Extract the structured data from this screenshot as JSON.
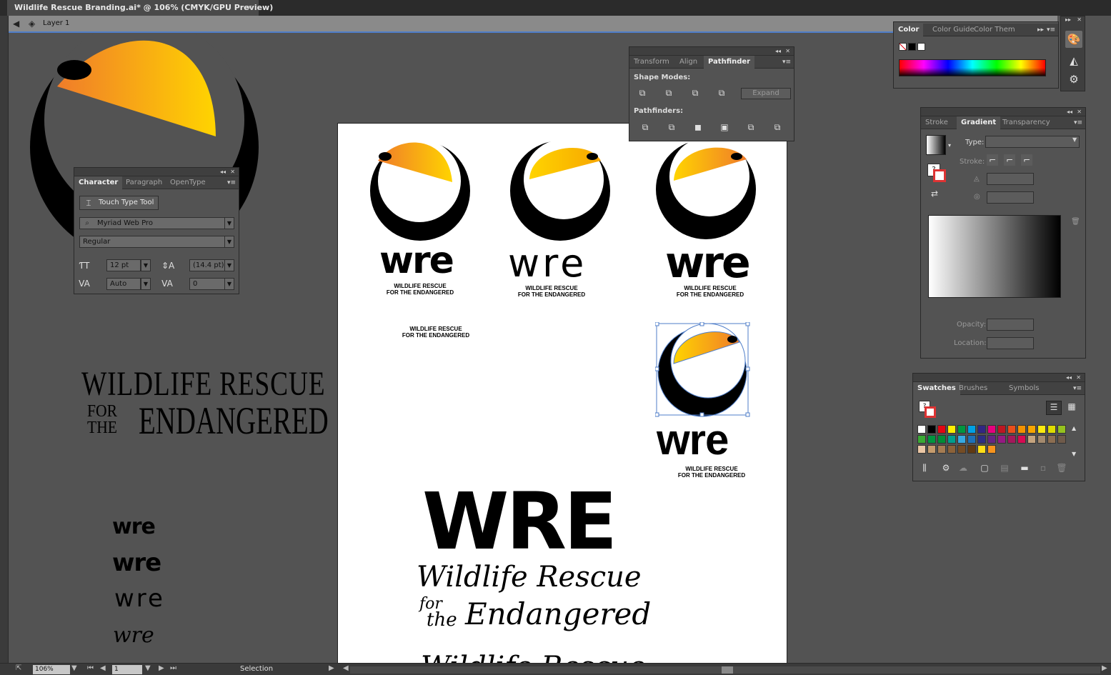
{
  "document_tab": {
    "title": "Wildlife Rescue Branding.ai* @ 106% (CMYK/GPU Preview)",
    "close": "×"
  },
  "layer_bar": {
    "layer_name": "Layer 1"
  },
  "canvas": {
    "logo_word": "wre",
    "logo_word_thin": "wre",
    "tagline_line1": "WILDLIFE RESCUE",
    "tagline_line2": "FOR THE ENDANGERED",
    "serif_line1": "WILDLIFE RESCUE",
    "serif_for": "FOR",
    "serif_the": "THE",
    "serif_endangered": "ENDANGERED",
    "wre_samples": [
      "wre",
      "wre",
      "wre",
      "wre"
    ],
    "big_caps": "WRE",
    "script_line1": "Wildlife Rescue",
    "script_for": "for",
    "script_the": "the",
    "script_endangered": "Endangered",
    "script_partial": "Wildlife Rescue"
  },
  "character_panel": {
    "tabs": [
      "Character",
      "Paragraph",
      "OpenType"
    ],
    "touch_type_button": "Touch Type Tool",
    "font_family": "Myriad Web Pro",
    "font_style": "Regular",
    "font_size": "12 pt",
    "leading": "(14.4 pt)",
    "kerning": "Auto",
    "tracking": "0"
  },
  "pathfinder_panel": {
    "tabs": [
      "Transform",
      "Align",
      "Pathfinder"
    ],
    "shape_modes_label": "Shape Modes:",
    "pathfinders_label": "Pathfinders:",
    "expand_button": "Expand"
  },
  "color_panel": {
    "tabs": [
      "Color",
      "Color Guide",
      "Color Them"
    ]
  },
  "gradient_panel": {
    "tabs": [
      "Stroke",
      "Gradient",
      "Transparency"
    ],
    "type_label": "Type:",
    "stroke_label": "Stroke:",
    "opacity_label": "Opacity:",
    "location_label": "Location:"
  },
  "swatches_panel": {
    "tabs": [
      "Swatches",
      "Brushes",
      "Symbols"
    ],
    "colors": [
      "#ffffff",
      "#000000",
      "#e30613",
      "#ffed00",
      "#009640",
      "#00a0e3",
      "#312783",
      "#e6007e",
      "#be1622",
      "#e94e1b",
      "#f39200",
      "#f7a600",
      "#fcea10",
      "#dedc00",
      "#95c11f",
      "#3aaa35",
      "#00963f",
      "#008d36",
      "#009e8d",
      "#36a9e1",
      "#1d71b8",
      "#2d2e83",
      "#662483",
      "#951b81",
      "#a3195b",
      "#d60b52",
      "#c5a47e",
      "#a48a6e",
      "#8c6e51",
      "#6f5a4a",
      "#ebc7a5",
      "#c69c6d",
      "#a67c52",
      "#8c6239",
      "#754c24",
      "#603913",
      "#ffde17",
      "#f7941d"
    ]
  },
  "statusbar": {
    "zoom": "106%",
    "page": "1",
    "tool": "Selection"
  },
  "colors": {
    "beak_start": "#f07c2a",
    "beak_end": "#ffd400",
    "selection": "#4f7ec9"
  }
}
